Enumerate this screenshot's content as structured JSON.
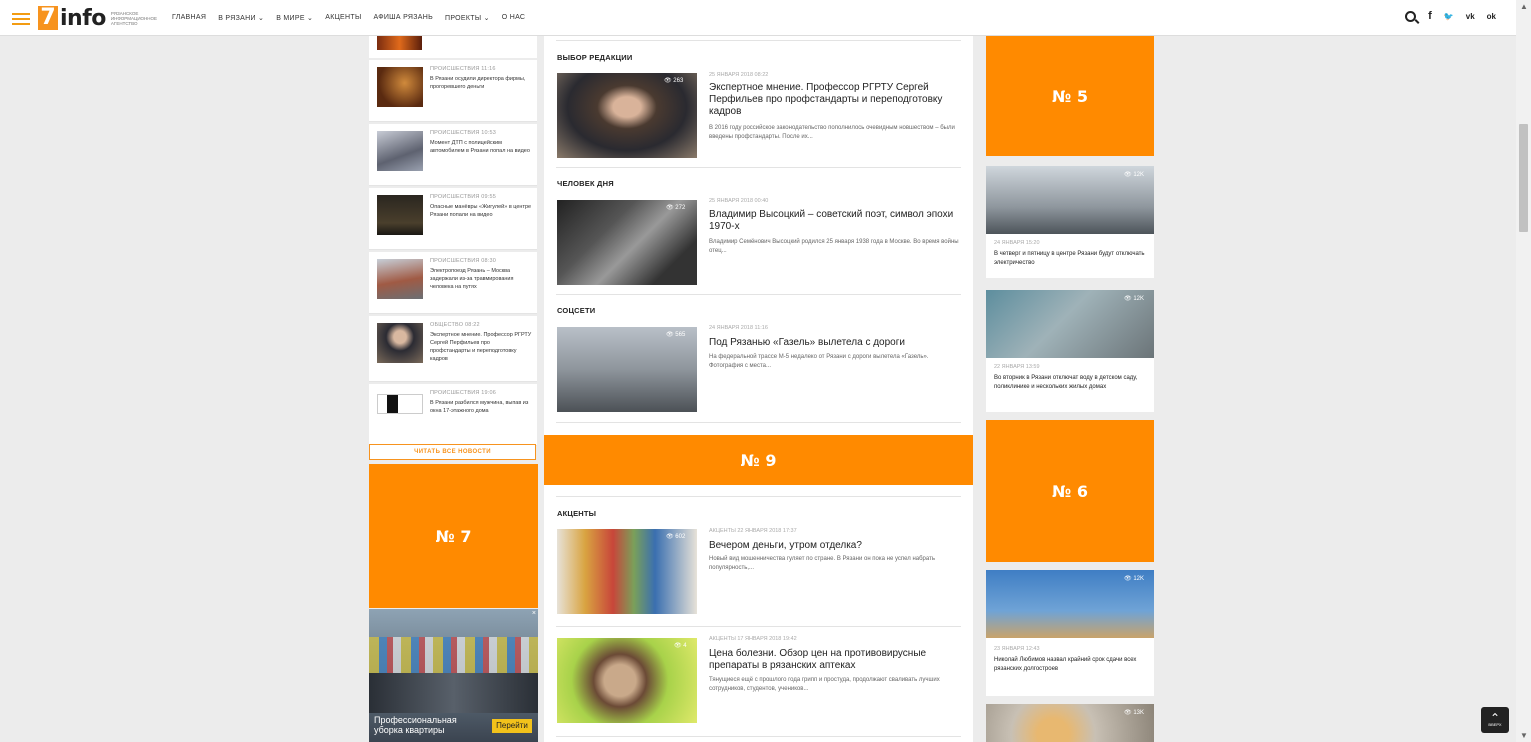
{
  "header": {
    "logo_num": "7",
    "logo_word": "info",
    "logo_sub": "РЯЗАНСКОЕ ИНФОРМАЦИОННОЕ АГЕНТСТВО",
    "menu": [
      "ГЛАВНАЯ",
      "В РЯЗАНИ ⌄",
      "В МИРЕ ⌄",
      "АКЦЕНТЫ",
      "АФИША РЯЗАНЬ",
      "ПРОЕКТЫ ⌄",
      "О НАС"
    ],
    "social": {
      "facebook": "f",
      "twitter": "🐦",
      "vk": "vk",
      "ok": "ok"
    }
  },
  "left_news": [
    {
      "meta": "ПРОИСШЕСТВИЯ 11:16",
      "title": "В Рязани осудили директора фирмы, прогоревшего деньги"
    },
    {
      "meta": "ПРОИСШЕСТВИЯ 10:53",
      "title": "Момент ДТП с полицейским автомобилем в Рязани попал на видео"
    },
    {
      "meta": "ПРОИСШЕСТВИЯ 09:55",
      "title": "Опасные манёвры «Жигулей» в центре Рязани попали на видео"
    },
    {
      "meta": "ПРОИСШЕСТВИЯ 08:30",
      "title": "Электропоезд Рязань – Москва задержали из-за травмирования человека на путях"
    },
    {
      "meta": "ОБЩЕСТВО 08:22",
      "title": "Экспертное мнение. Профессор РГРТУ Сергей Перфильев про профстандарты и переподготовку кадров"
    },
    {
      "meta": "ПРОИСШЕСТВИЯ 19:06",
      "title": "В Рязани разбился мужчина, выпав из окна 17-этажного дома"
    }
  ],
  "read_all_label": "ЧИТАТЬ ВСЕ НОВОСТИ",
  "ads": {
    "ad7": "№ 7",
    "ad9": "№ 9",
    "ad5": "№ 5",
    "ad6": "№ 6"
  },
  "promo": {
    "text": "Профессиональная уборка квартиры",
    "button": "Перейти",
    "close": "×"
  },
  "middle": {
    "sections": [
      {
        "title": "ВЫБОР РЕДАКЦИИ",
        "views": "👁 263",
        "meta": "25 ЯНВАРЯ 2018 08:22",
        "headline": "Экспертное мнение. Профессор РГРТУ Сергей Перфильев про профстандарты и переподготовку кадров",
        "lead": "В 2016 году российское законодательство пополнилось очевидным новшеством – были введены профстандарты. После их..."
      },
      {
        "title": "ЧЕЛОВЕК ДНЯ",
        "views": "👁 272",
        "meta": "25 ЯНВАРЯ 2018 00:40",
        "headline": "Владимир Высоцкий – советский поэт, символ эпохи 1970-х",
        "lead": "Владимир Семёнович Высоцкий родился 25 января 1938 года в Москве. Во время войны отец..."
      },
      {
        "title": "СОЦСЕТИ",
        "views": "👁 565",
        "meta": "24 ЯНВАРЯ 2018 11:16",
        "headline": "Под Рязанью «Газель» вылетела с дороги",
        "lead": "На федеральной трассе М-5 недалеко от Рязани с дороги вылетела «Газель». Фотография с места..."
      }
    ],
    "accents_title": "АКЦЕНТЫ",
    "accents": [
      {
        "views": "👁 602",
        "meta": "АКЦЕНТЫ 22 ЯНВАРЯ 2018 17:37",
        "headline": "Вечером деньги, утром отделка?",
        "lead": "Новый вид мошенничества гуляет по стране. В Рязани он пока не успел набрать популярность,..."
      },
      {
        "views": "👁 4",
        "meta": "АКЦЕНТЫ 17 ЯНВАРЯ 2018 19:42",
        "headline": "Цена болезни. Обзор цен на противовирусные препараты в рязанских аптеках",
        "lead": "Тянущиеся ещё с прошлого года грипп и простуда, продолжают сваливать лучших сотрудников, студентов, учеников..."
      }
    ]
  },
  "right_news": [
    {
      "views": "👁 12K",
      "meta": "24 ЯНВАРЯ 15:20",
      "title": "В четверг и пятницу в центре Рязани будут отключать электричество"
    },
    {
      "views": "👁 12K",
      "meta": "22 ЯНВАРЯ 13:59",
      "title": "Во вторник в Рязани отключат воду в детском саду, поликлинике и нескольких жилых домах"
    },
    {
      "views": "👁 12K",
      "meta": "23 ЯНВАРЯ 12:43",
      "title": "Николай Любимов назвал крайний срок сдачи всех рязанских долгостроев"
    },
    {
      "views": "👁 13K"
    }
  ],
  "totop": {
    "arrow": "⌃",
    "label": "ВВЕРХ"
  }
}
